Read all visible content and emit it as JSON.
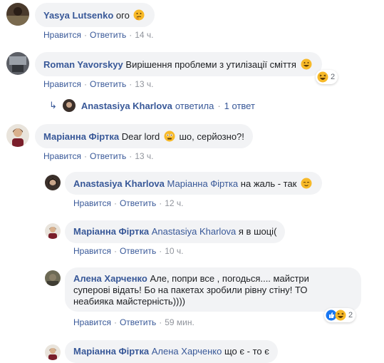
{
  "actions": {
    "like": "Нравится",
    "reply": "Ответить",
    "sep": "·"
  },
  "comments": [
    {
      "author": "Yasya Lutsenko",
      "text": "ого",
      "emoji": "thinking-face",
      "time": "14 ч."
    },
    {
      "author": "Roman Yavorskyy",
      "text": "Вирішення проблеми з утилізації сміття",
      "emoji": "grinning-face",
      "time": "13 ч.",
      "reaction_count": "2",
      "replies_summary": {
        "who": "Anastasiya Kharlova",
        "verb": "ответила",
        "count": "1 ответ"
      }
    },
    {
      "author": "Маріанна Фіртка",
      "text_before": "Dear lord",
      "emoji": "flushed-face",
      "text_after": "шо, серйозно?!",
      "time": "13 ч."
    }
  ],
  "replies": [
    {
      "author": "Anastasiya Kharlova",
      "mention": "Маріанна Фіртка",
      "text": "на жаль - так",
      "emoji": "relieved-face",
      "time": "12 ч."
    },
    {
      "author": "Маріанна Фіртка",
      "mention": "Anastasiya Kharlova",
      "text": "я в шоці(",
      "time": "10 ч."
    },
    {
      "author": "Алена Харченко",
      "text_line1": "Але, попри все , погодься.... майстри",
      "text_line2": "суперові відать! Бо на пакетах зробили рівну стіну! ТО",
      "text_line3": "неабияка майстерність))))",
      "time": "59 мин.",
      "reaction_count": "2"
    },
    {
      "author": "Маріанна Фіртка",
      "mention": "Алена Харченко",
      "text": "що є - то є"
    }
  ],
  "colors": {
    "link": "#385898",
    "bubble": "#f2f3f5",
    "meta": "#90949c",
    "like_blue": "#1877f2",
    "emoji_yellow": "#f7b928"
  }
}
